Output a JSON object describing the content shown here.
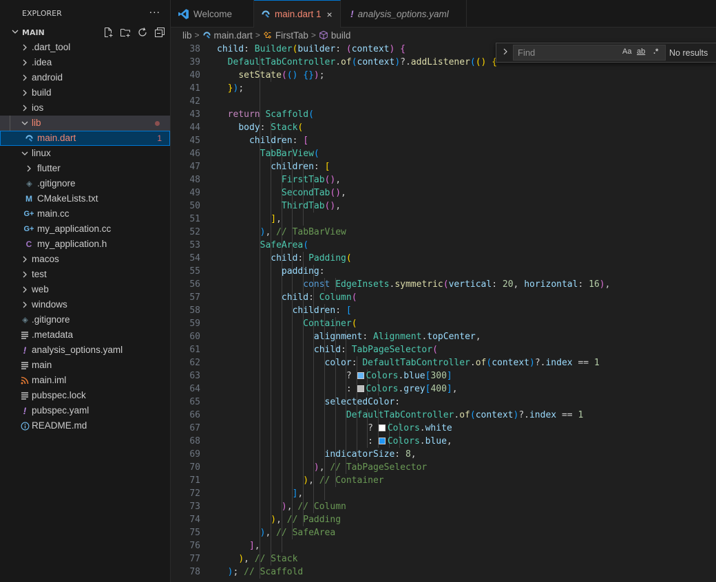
{
  "sidebar": {
    "title": "EXPLORER",
    "more": "···",
    "folder": "MAIN",
    "tree": [
      {
        "label": ".dart_tool",
        "icon": "chevron-right-icon"
      },
      {
        "label": ".idea",
        "icon": "chevron-right-icon"
      },
      {
        "label": "android",
        "icon": "chevron-right-icon"
      },
      {
        "label": "build",
        "icon": "chevron-right-icon"
      },
      {
        "label": "ios",
        "icon": "chevron-right-icon"
      },
      {
        "label": "lib",
        "icon": "chevron-down-icon"
      },
      {
        "label": "main.dart",
        "icon": "dart-file-icon",
        "badge": "1"
      },
      {
        "label": "linux",
        "icon": "chevron-down-icon"
      },
      {
        "label": "flutter",
        "icon": "chevron-right-icon"
      },
      {
        "label": ".gitignore",
        "icon": "git-icon"
      },
      {
        "label": "CMakeLists.txt",
        "icon": "cmake-icon"
      },
      {
        "label": "main.cc",
        "icon": "cpp-icon"
      },
      {
        "label": "my_application.cc",
        "icon": "cpp-icon"
      },
      {
        "label": "my_application.h",
        "icon": "c-header-icon"
      },
      {
        "label": "macos",
        "icon": "chevron-right-icon"
      },
      {
        "label": "test",
        "icon": "chevron-right-icon"
      },
      {
        "label": "web",
        "icon": "chevron-right-icon"
      },
      {
        "label": "windows",
        "icon": "chevron-right-icon"
      },
      {
        "label": ".gitignore",
        "icon": "git-icon"
      },
      {
        "label": ".metadata",
        "icon": "lines-file-icon"
      },
      {
        "label": "analysis_options.yaml",
        "icon": "yaml-icon"
      },
      {
        "label": "main",
        "icon": "lines-file-icon"
      },
      {
        "label": "main.iml",
        "icon": "rss-icon"
      },
      {
        "label": "pubspec.lock",
        "icon": "lines-file-icon"
      },
      {
        "label": "pubspec.yaml",
        "icon": "yaml-icon"
      },
      {
        "label": "README.md",
        "icon": "info-icon"
      }
    ]
  },
  "tabs": [
    {
      "label": "Welcome",
      "icon": "vscode-icon"
    },
    {
      "label": "main.dart 1",
      "icon": "dart-file-icon",
      "close": "×"
    },
    {
      "label": "analysis_options.yaml",
      "icon": "yaml-icon"
    }
  ],
  "breadcrumb": {
    "items": [
      "lib",
      "main.dart",
      "FirstTab",
      "build"
    ],
    "separator": ">"
  },
  "find": {
    "placeholder": "Find",
    "match_case": "Aa",
    "whole_word": "ab",
    "regex": ".*",
    "result": "No results"
  },
  "editor": {
    "lines": [
      {
        "n": "38",
        "text": "        child: Builder(builder: (context) {"
      },
      {
        "n": "39",
        "text": "          DefaultTabController.of(context)?.addListener(() {"
      },
      {
        "n": "40",
        "text": "            setState(() {});"
      },
      {
        "n": "41",
        "text": "          });"
      },
      {
        "n": "42",
        "text": ""
      },
      {
        "n": "43",
        "text": "          return Scaffold("
      },
      {
        "n": "44",
        "text": "            body: Stack("
      },
      {
        "n": "45",
        "text": "              children: ["
      },
      {
        "n": "46",
        "text": "                TabBarView("
      },
      {
        "n": "47",
        "text": "                  children: ["
      },
      {
        "n": "48",
        "text": "                    FirstTab(),"
      },
      {
        "n": "49",
        "text": "                    SecondTab(),"
      },
      {
        "n": "50",
        "text": "                    ThirdTab(),"
      },
      {
        "n": "51",
        "text": "                  ],"
      },
      {
        "n": "52",
        "text": "                ), // TabBarView"
      },
      {
        "n": "53",
        "text": "                SafeArea("
      },
      {
        "n": "54",
        "text": "                  child: Padding("
      },
      {
        "n": "55",
        "text": "                    padding:"
      },
      {
        "n": "56",
        "text": "                        const EdgeInsets.symmetric(vertical: 20, horizontal: 16),"
      },
      {
        "n": "57",
        "text": "                    child: Column("
      },
      {
        "n": "58",
        "text": "                      children: ["
      },
      {
        "n": "59",
        "text": "                        Container("
      },
      {
        "n": "60",
        "text": "                          alignment: Alignment.topCenter,"
      },
      {
        "n": "61",
        "text": "                          child: TabPageSelector("
      },
      {
        "n": "62",
        "text": "                            color: DefaultTabController.of(context)?.index == 1"
      },
      {
        "n": "63",
        "text": "                                ? Colors.blue[300]"
      },
      {
        "n": "64",
        "text": "                                : Colors.grey[400],"
      },
      {
        "n": "65",
        "text": "                            selectedColor:"
      },
      {
        "n": "66",
        "text": "                                DefaultTabController.of(context)?.index == 1"
      },
      {
        "n": "67",
        "text": "                                    ? Colors.white"
      },
      {
        "n": "68",
        "text": "                                    : Colors.blue,"
      },
      {
        "n": "69",
        "text": "                            indicatorSize: 8,"
      },
      {
        "n": "70",
        "text": "                          ), // TabPageSelector"
      },
      {
        "n": "71",
        "text": "                        ), // Container"
      },
      {
        "n": "72",
        "text": "                      ],"
      },
      {
        "n": "73",
        "text": "                    ), // Column"
      },
      {
        "n": "74",
        "text": "                  ), // Padding"
      },
      {
        "n": "75",
        "text": "                ), // SafeArea"
      },
      {
        "n": "76",
        "text": "              ],"
      },
      {
        "n": "77",
        "text": "            ), // Stack"
      },
      {
        "n": "78",
        "text": "          ); // Scaffold"
      }
    ],
    "swatches": {
      "blue300": "#64b5f6",
      "grey400": "#bdbdbd",
      "white": "#ffffff",
      "blue": "#2196f3"
    }
  },
  "colors": {
    "accent": "#0078d4",
    "error": "#f48771",
    "background": "#1f1f1f",
    "sidebar": "#181818"
  }
}
